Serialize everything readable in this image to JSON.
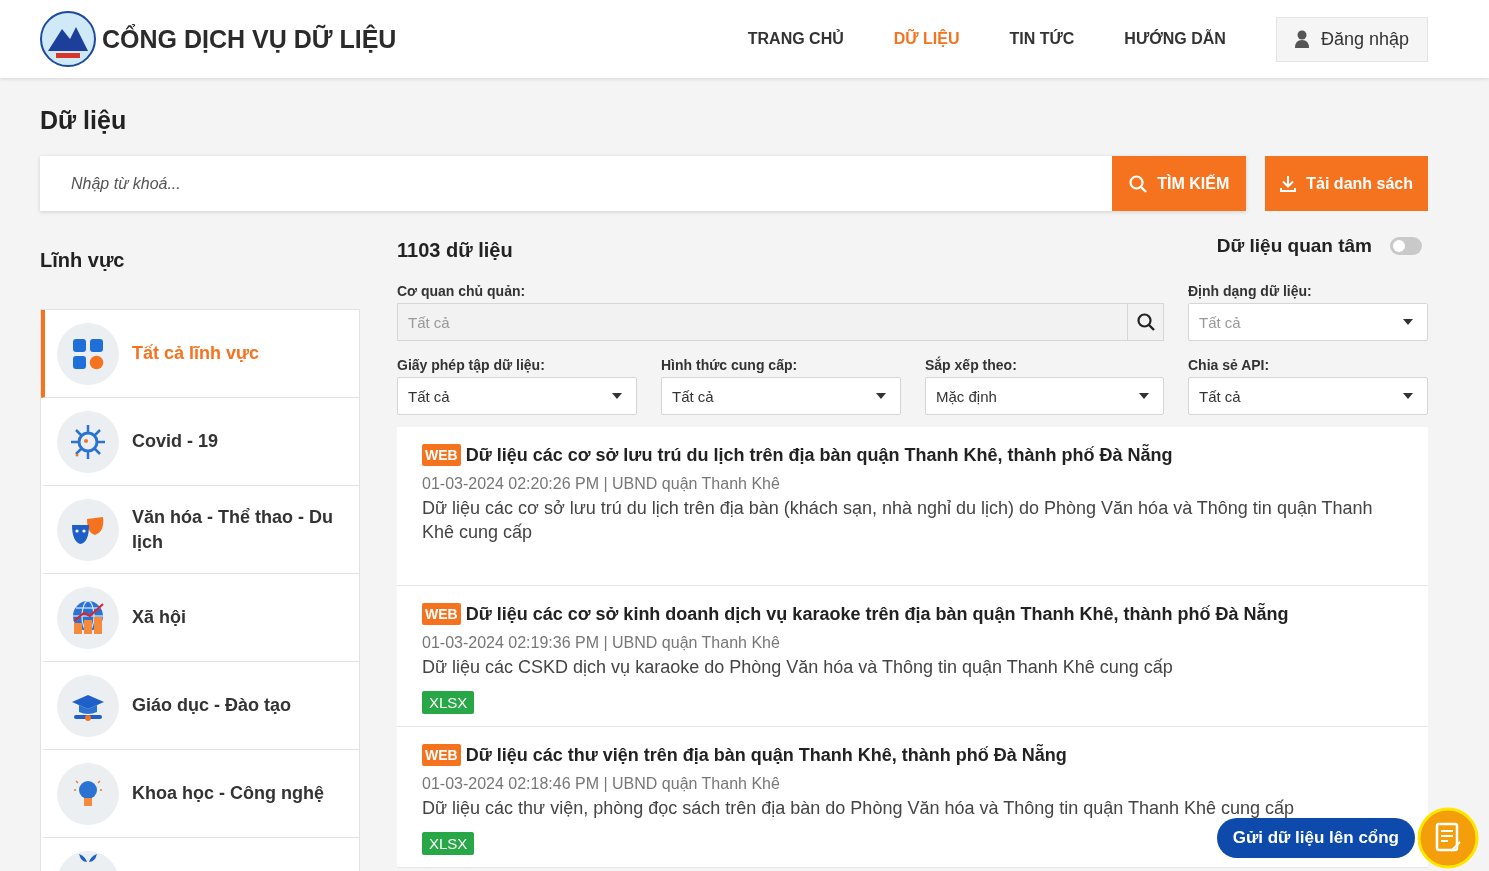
{
  "header": {
    "site_title": "CỔNG DỊCH VỤ DỮ LIỆU",
    "nav": [
      {
        "label": "TRANG CHỦ",
        "selected": false
      },
      {
        "label": "DỮ LIỆU",
        "selected": true
      },
      {
        "label": "TIN TỨC",
        "selected": false
      },
      {
        "label": "HƯỚNG DẪN",
        "selected": false
      }
    ],
    "login_button": "Đăng nhập"
  },
  "page_title": "Dữ liệu",
  "search": {
    "placeholder": "Nhập từ khoá...",
    "search_button": "TÌM KIẾM",
    "download_button": "Tải danh sách"
  },
  "sidebar": {
    "title": "Lĩnh vực",
    "items": [
      {
        "label": "Tất cả lĩnh vực",
        "kind": "grid",
        "selected": true
      },
      {
        "label": "Covid - 19",
        "kind": "virus",
        "selected": false
      },
      {
        "label": "Văn hóa - Thể thao - Du lịch",
        "kind": "masks",
        "selected": false
      },
      {
        "label": "Xã hội",
        "kind": "globe",
        "selected": false
      },
      {
        "label": "Giáo dục - Đào tạo",
        "kind": "graduation",
        "selected": false
      },
      {
        "label": "Khoa học - Công nghệ",
        "kind": "bulb",
        "selected": false
      },
      {
        "kind": "leaf",
        "selected": false
      }
    ]
  },
  "results": {
    "count": "1103 dữ liệu",
    "favorites_toggle": {
      "label": "Dữ liệu quan tâm",
      "on": false
    },
    "filters": [
      {
        "kind": "search",
        "label": "Cơ quan chủ quản:",
        "placeholder": "Tất cả"
      },
      {
        "kind": "select",
        "label": "Định dạng dữ liệu:",
        "placeholder": "Tất cả"
      },
      {
        "kind": "select",
        "label": "Giấy phép tập dữ liệu:",
        "value": "Tất cả"
      },
      {
        "kind": "select",
        "label": "Hình thức cung cấp:",
        "value": "Tất cả"
      },
      {
        "kind": "select",
        "label": "Sắp xếp theo:",
        "value": "Mặc định"
      },
      {
        "kind": "select",
        "label": "Chia sẻ API:",
        "value": "Tất cả"
      }
    ],
    "datasets": [
      {
        "badge": "WEB",
        "title": "Dữ liệu các cơ sở lưu trú du lịch trên địa bàn quận Thanh Khê, thành phố Đà Nẵng",
        "meta": "01-03-2024 02:20:26 PM | UBND quận Thanh Khê",
        "description": "Dữ liệu các cơ sở lưu trú du lịch trên địa bàn (khách sạn, nhà nghỉ du lịch) do Phòng Văn hóa và Thông tin quận Thanh Khê cung cấp"
      },
      {
        "badge": "WEB",
        "title": "Dữ liệu các cơ sở kinh doanh dịch vụ karaoke trên địa bàn quận Thanh Khê, thành phố Đà Nẵng",
        "meta": "01-03-2024 02:19:36 PM | UBND quận Thanh Khê",
        "description": "Dữ liệu các CSKD dịch vụ karaoke do Phòng Văn hóa và Thông tin quận Thanh Khê cung cấp",
        "formats": [
          "XLSX"
        ]
      },
      {
        "badge": "WEB",
        "title": "Dữ liệu các thư viện trên địa bàn quận Thanh Khê, thành phố Đà Nẵng",
        "meta": "01-03-2024 02:18:46 PM | UBND quận Thanh Khê",
        "description": "Dữ liệu các thư viện, phòng đọc sách trên địa bàn do Phòng Văn hóa và Thông tin quận Thanh Khê cung cấp",
        "formats": [
          "XLSX"
        ]
      }
    ]
  },
  "submit_button": "Gửi dữ liệu lên cổng"
}
